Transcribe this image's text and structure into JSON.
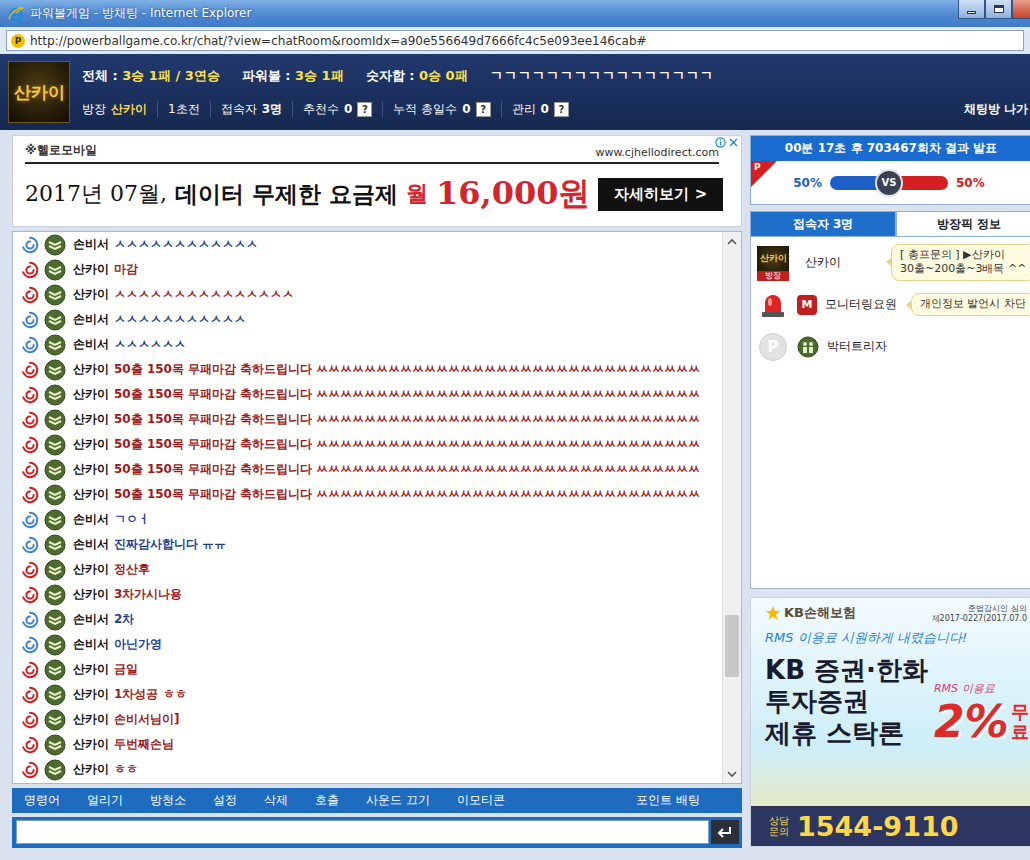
{
  "window": {
    "title": "파워볼게임 - 방채팅 - Internet Explorer"
  },
  "address_bar": {
    "icon": "P",
    "url": "http://powerballgame.co.kr/chat/?view=chatRoom&roomIdx=a90e556649d7666fc4c5e093ee146cab#"
  },
  "header": {
    "logo": "산카이",
    "stats": [
      {
        "label": "전체 : ",
        "value": "3승 1패 / 3연승"
      },
      {
        "label": "파워볼 : ",
        "value": "3승 1패"
      },
      {
        "label": "숫자합 : ",
        "value": "0승 0패"
      }
    ],
    "room_title": "ㄱㄱㄱㄱㄱㄱㄱㄱㄱㄱㄱㄱㄱㄱㄱㄱ",
    "info": [
      {
        "label": "방장",
        "value": "산카이",
        "help": "",
        "color": "#ffd84a"
      },
      {
        "label": "1초전",
        "value": "",
        "help": "",
        "color": "#ffffff"
      },
      {
        "label": "접속자",
        "value": "3명",
        "help": "",
        "color": "#ffffff"
      },
      {
        "label": "추천수",
        "value": "0",
        "help": "?",
        "color": "#ffffff"
      },
      {
        "label": "누적 총일수",
        "value": "0",
        "help": "?",
        "color": "#ffffff"
      },
      {
        "label": "관리",
        "value": "0",
        "help": "?",
        "color": "#ffffff"
      }
    ],
    "exit": "채팅방 나가"
  },
  "banner_ad": {
    "brand": "※헬로모바일",
    "url": "www.cjhellodirect.com",
    "date": "2017년 07월,",
    "headline": "데이터 무제한 요금제",
    "price_prefix": "월",
    "price": "16,000원",
    "button": "자세히보기 >"
  },
  "chat": {
    "scroll": {
      "position": 0.71,
      "size": 0.12
    },
    "messages": [
      {
        "user": "손비서",
        "text": "ㅅㅅㅅㅅㅅㅅㅅㅅㅅㅅㅅㅅ",
        "kind": "guest",
        "color": "#1f3f8f"
      },
      {
        "user": "산카이",
        "text": "마감",
        "kind": "owner",
        "color": "#9b1c1c"
      },
      {
        "user": "산카이",
        "text": "ㅅㅅㅅㅅㅅㅅㅅㅅㅅㅅㅅㅅㅅㅅㅅ",
        "kind": "owner",
        "color": "#9b1c1c"
      },
      {
        "user": "손비서",
        "text": "ㅅㅅㅅㅅㅅㅅㅅㅅㅅㅅㅅ",
        "kind": "guest",
        "color": "#1f3f8f"
      },
      {
        "user": "손비서",
        "text": "ㅅㅅㅅㅅㅅㅅ",
        "kind": "guest",
        "color": "#1f3f8f"
      },
      {
        "user": "산카이",
        "text": "50출 150목 무패마감 축하드립니다 ㅆㅆㅆㅆㅆㅆㅆㅆㅆㅆㅆㅆㅆㅆㅆㅆㅆㅆㅆㅆㅆㅆㅆㅆㅆㅆㅆㅆㅆㅆㅆㅆ",
        "kind": "owner",
        "color": "#9b1c1c"
      },
      {
        "user": "산카이",
        "text": "50출 150목 무패마감 축하드립니다 ㅆㅆㅆㅆㅆㅆㅆㅆㅆㅆㅆㅆㅆㅆㅆㅆㅆㅆㅆㅆㅆㅆㅆㅆㅆㅆㅆㅆㅆㅆㅆㅆ",
        "kind": "owner",
        "color": "#9b1c1c"
      },
      {
        "user": "산카이",
        "text": "50출 150목 무패마감 축하드립니다 ㅆㅆㅆㅆㅆㅆㅆㅆㅆㅆㅆㅆㅆㅆㅆㅆㅆㅆㅆㅆㅆㅆㅆㅆㅆㅆㅆㅆㅆㅆㅆㅆ",
        "kind": "owner",
        "color": "#9b1c1c"
      },
      {
        "user": "산카이",
        "text": "50출 150목 무패마감 축하드립니다 ㅆㅆㅆㅆㅆㅆㅆㅆㅆㅆㅆㅆㅆㅆㅆㅆㅆㅆㅆㅆㅆㅆㅆㅆㅆㅆㅆㅆㅆㅆㅆㅆ",
        "kind": "owner",
        "color": "#9b1c1c"
      },
      {
        "user": "산카이",
        "text": "50출 150목 무패마감 축하드립니다 ㅆㅆㅆㅆㅆㅆㅆㅆㅆㅆㅆㅆㅆㅆㅆㅆㅆㅆㅆㅆㅆㅆㅆㅆㅆㅆㅆㅆㅆㅆㅆㅆ",
        "kind": "owner",
        "color": "#9b1c1c"
      },
      {
        "user": "산카이",
        "text": "50출 150목 무패마감 축하드립니다 ㅆㅆㅆㅆㅆㅆㅆㅆㅆㅆㅆㅆㅆㅆㅆㅆㅆㅆㅆㅆㅆㅆㅆㅆㅆㅆㅆㅆㅆㅆㅆㅆ",
        "kind": "owner",
        "color": "#9b1c1c"
      },
      {
        "user": "손비서",
        "text": "ㄱㅇㅓ",
        "kind": "guest",
        "color": "#1f3f8f"
      },
      {
        "user": "손비서",
        "text": "진짜감사합니다 ㅠㅠ",
        "kind": "guest",
        "color": "#1f3f8f"
      },
      {
        "user": "산카이",
        "text": "정산후",
        "kind": "owner",
        "color": "#9b1c1c"
      },
      {
        "user": "산카이",
        "text": "3차가시나용",
        "kind": "owner",
        "color": "#9b1c1c"
      },
      {
        "user": "손비서",
        "text": "2차",
        "kind": "guest",
        "color": "#1f3f8f"
      },
      {
        "user": "손비서",
        "text": "아닌가영",
        "kind": "guest",
        "color": "#1f3f8f"
      },
      {
        "user": "산카이",
        "text": "금일",
        "kind": "owner",
        "color": "#9b1c1c"
      },
      {
        "user": "산카이",
        "text": "1차성공 ㅎㅎ",
        "kind": "owner",
        "color": "#9b1c1c"
      },
      {
        "user": "산카이",
        "text": "손비서님이]",
        "kind": "owner",
        "color": "#9b1c1c"
      },
      {
        "user": "산카이",
        "text": "두번째손님",
        "kind": "owner",
        "color": "#9b1c1c"
      },
      {
        "user": "산카이",
        "text": "ㅎㅎ",
        "kind": "owner",
        "color": "#9b1c1c"
      }
    ]
  },
  "toolbar": {
    "items": [
      "명령어",
      "얼리기",
      "방청소",
      "설정",
      "삭제",
      "호출",
      "사운드 끄기",
      "이모티콘"
    ],
    "point": "포인트 배팅"
  },
  "round": {
    "countdown": "00분 17초 후 703467회차 결과 발표",
    "icon": "P",
    "vs": "VS",
    "left": {
      "reading": "50%",
      "level": 0.5,
      "color": "#1f5fc8"
    },
    "right": {
      "reading": "50%",
      "level": 0.5,
      "color": "#d42020"
    }
  },
  "tabs": [
    {
      "label": "접속자 3명",
      "selected": true
    },
    {
      "label": "방장픽 정보",
      "selected": false
    }
  ],
  "users": [
    {
      "name": "산카이",
      "avatar": {
        "kind": "logo",
        "text": "산카이",
        "badge": "방장"
      },
      "rank": {
        "kind": "chevron",
        "text": ""
      },
      "bubble_lines": [
        "[ 총프문의 ] ▶산카이",
        "30출~200출~3배목 ^^"
      ]
    },
    {
      "name": "모니터링요원",
      "avatar": {
        "kind": "siren",
        "text": "",
        "badge": ""
      },
      "rank": {
        "kind": "letter",
        "text": "M"
      },
      "bubble_lines": [
        "개인정보 발언시 차단"
      ]
    },
    {
      "name": "박터트리자",
      "avatar": {
        "kind": "circle",
        "text": "P",
        "badge": ""
      },
      "rank": {
        "kind": "people",
        "text": ""
      },
      "bubble_lines": []
    }
  ],
  "side_ad": {
    "brand": "KB손해보험",
    "notice_lines": [
      "준법감시인 심의",
      "제2017-0227(2017.07.0"
    ],
    "slogan": "RMS 이용료 시원하게 내렸습니다!",
    "title_lines": [
      "KB 증권·한화",
      "투자증권",
      "제휴 스탁론"
    ],
    "tag": "RMS 이용료",
    "rate": "2%",
    "rate_suffix_lines": [
      "무",
      "료"
    ],
    "contact_lines": [
      "상담",
      "문의"
    ],
    "phone": "1544-9110"
  }
}
